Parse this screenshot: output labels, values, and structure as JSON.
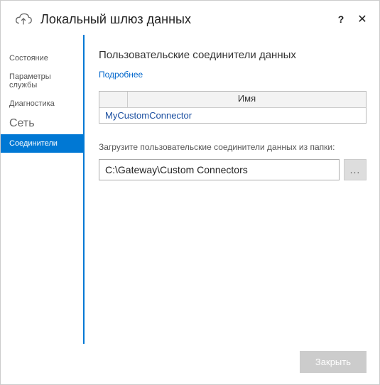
{
  "titlebar": {
    "title": "Локальный шлюз данных",
    "help": "?",
    "close": "✕"
  },
  "sidebar": {
    "items": [
      {
        "label": "Состояние",
        "selected": false,
        "large": false
      },
      {
        "label": "Параметры службы",
        "selected": false,
        "large": false
      },
      {
        "label": "Диагностика",
        "selected": false,
        "large": false
      },
      {
        "label": "Сеть",
        "selected": false,
        "large": true
      },
      {
        "label": "Соединители",
        "selected": true,
        "large": false
      }
    ]
  },
  "main": {
    "section_title": "Пользовательские соединители данных",
    "more_link": "Подробнее",
    "table": {
      "header_name": "Имя",
      "rows": [
        {
          "name": "MyCustomConnector"
        }
      ]
    },
    "folder_label": "Загрузите пользовательские соединители данных из папки:",
    "folder_value": "C:\\Gateway\\Custom Connectors",
    "browse_label": "..."
  },
  "footer": {
    "close_label": "Закрыть"
  }
}
